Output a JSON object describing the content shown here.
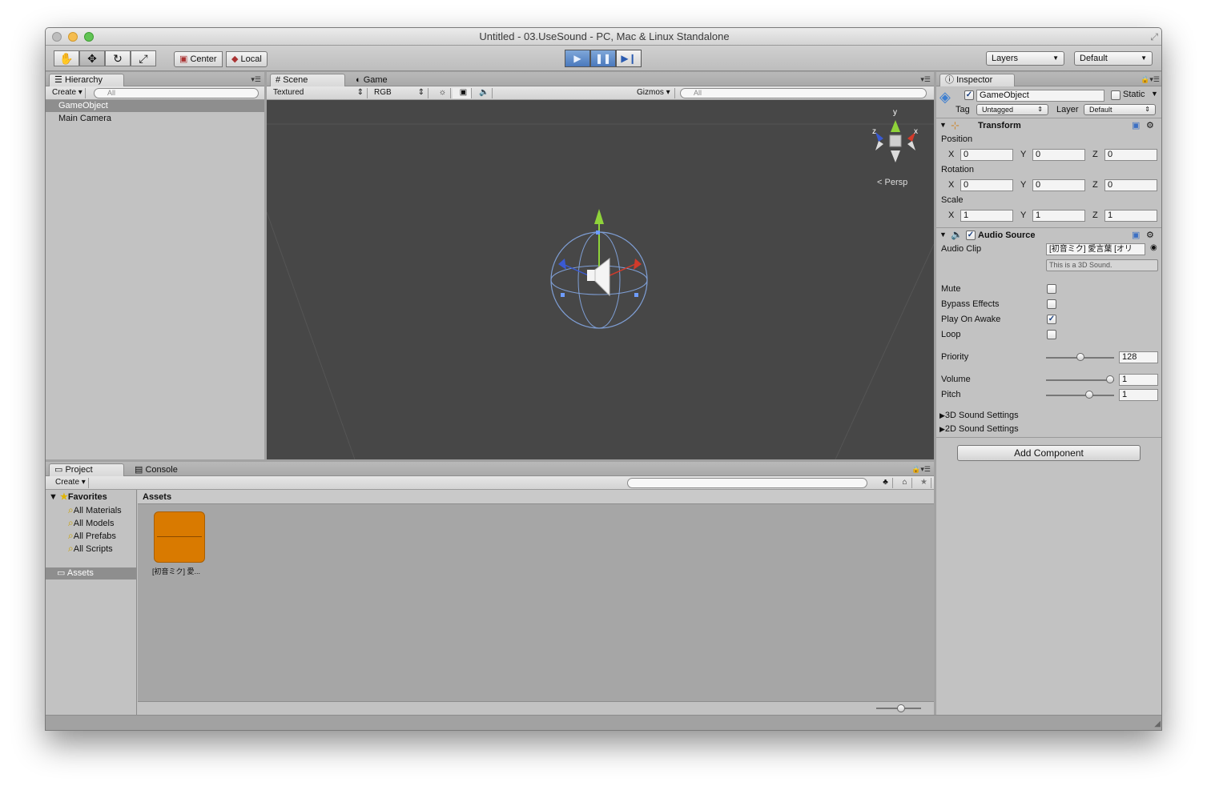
{
  "window": {
    "title": "Untitled - 03.UseSound - PC, Mac & Linux Standalone"
  },
  "toolbar": {
    "tools": [
      {
        "name": "hand-tool",
        "glyph": "✋"
      },
      {
        "name": "move-tool",
        "glyph": "✥"
      },
      {
        "name": "rotate-tool",
        "glyph": "↻"
      },
      {
        "name": "scale-tool",
        "glyph": "⤢"
      }
    ],
    "pivot": "Center",
    "space": "Local",
    "playback": [
      {
        "name": "play-button",
        "glyph": "▶"
      },
      {
        "name": "pause-button",
        "glyph": "❚❚"
      },
      {
        "name": "step-button",
        "glyph": "▶❙"
      }
    ],
    "layers": "Layers",
    "layout": "Default"
  },
  "hierarchy": {
    "tab": "Hierarchy",
    "create": "Create",
    "search_placeholder": "All",
    "items": [
      "GameObject",
      "Main Camera"
    ],
    "selected_index": 0
  },
  "scene": {
    "tabs": [
      "Scene",
      "Game"
    ],
    "render_mode": "Textured",
    "channel": "RGB",
    "gizmos": "Gizmos",
    "search_placeholder": "All",
    "axes": {
      "y": "y",
      "x": "x",
      "z": "z"
    },
    "view_label": "Persp"
  },
  "project": {
    "tabs": [
      "Project",
      "Console"
    ],
    "create": "Create",
    "favorites": {
      "label": "Favorites",
      "items": [
        "All Materials",
        "All Models",
        "All Prefabs",
        "All Scripts"
      ]
    },
    "assets_folder": "Assets",
    "breadcrumb": "Assets",
    "asset_items": [
      {
        "label": "[初音ミク] 愛...",
        "color": "#d97a00"
      }
    ]
  },
  "inspector": {
    "tab": "Inspector",
    "object_name": "GameObject",
    "static_label": "Static",
    "tag_label": "Tag",
    "tag_value": "Untagged",
    "layer_label": "Layer",
    "layer_value": "Default",
    "transform": {
      "title": "Transform",
      "position_label": "Position",
      "rotation_label": "Rotation",
      "scale_label": "Scale",
      "position": {
        "x": "0",
        "y": "0",
        "z": "0"
      },
      "rotation": {
        "x": "0",
        "y": "0",
        "z": "0"
      },
      "scale": {
        "x": "1",
        "y": "1",
        "z": "1"
      },
      "axis": {
        "x": "X",
        "y": "Y",
        "z": "Z"
      }
    },
    "audio_source": {
      "title": "Audio Source",
      "clip_label": "Audio Clip",
      "clip_value": "[初音ミク] 愛言葉 [オリ",
      "clip_hint": "This is a 3D Sound.",
      "mute_label": "Mute",
      "bypass_label": "Bypass Effects",
      "play_on_awake_label": "Play On Awake",
      "loop_label": "Loop",
      "mute": false,
      "bypass": false,
      "play_on_awake": true,
      "loop": false,
      "priority_label": "Priority",
      "priority": "128",
      "priority_fraction": 0.5,
      "volume_label": "Volume",
      "volume": "1",
      "volume_fraction": 1.0,
      "pitch_label": "Pitch",
      "pitch": "1",
      "pitch_fraction": 0.65,
      "sound3d_label": "3D Sound Settings",
      "sound2d_label": "2D Sound Settings"
    },
    "add_component": "Add Component"
  },
  "colors": {
    "play_active": "#4a79bd",
    "selection": "#8e8e8e",
    "scene_bg": "#474747",
    "asset_audio": "#d97a00"
  }
}
